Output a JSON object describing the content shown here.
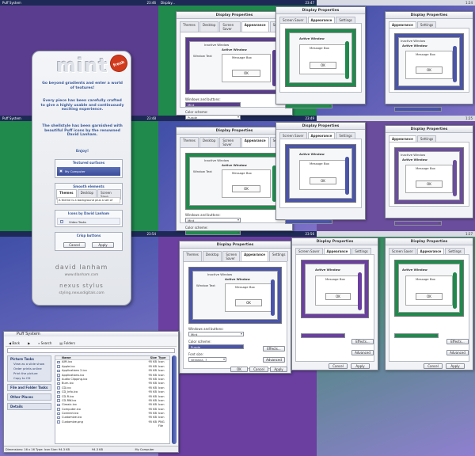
{
  "mint": {
    "logo": "mint",
    "badge": "fresh",
    "para1": "Go beyond gradients and enter a world of textures!",
    "para2": "Every piece has been carefully crafted to give a highly usable and continuously exciting experience.",
    "para3": "The shellstyle has been garnished with beautiful Puff icons by the renowned David Lanham.",
    "para4": "Enjoy!",
    "feature1_caption": "Textured surfaces",
    "feature1_item": "My Computer",
    "feature2_caption": "Smooth elements",
    "feature2_tabs": [
      "Themes",
      "Desktop",
      "Screen Save"
    ],
    "feature2_text": "A theme is a background plus a set of",
    "feature3_caption": "Icons by David Lanham",
    "feature3_item": "Video Tasks",
    "feature4_caption": "Crisp buttons",
    "feature4_cancel": "Cancel",
    "feature4_apply": "Apply",
    "brand1": "david lanham",
    "brand2": "www.dlanham.com",
    "brand3": "nexus stylus",
    "brand4": "styling.nexusdigitals.com"
  },
  "dialog": {
    "title": "Display Properties",
    "tabs": [
      "Themes",
      "Desktop",
      "Screen Saver",
      "Appearance",
      "Settings"
    ],
    "inactive_window": "Inactive Window",
    "active_window": "Active Window",
    "window_text": "Window Text",
    "message_box": "Message Box",
    "ok": "OK",
    "windows_buttons_label": "Windows and buttons:",
    "windows_buttons_value": "Mint",
    "color_scheme_label": "Color scheme:",
    "color_scheme_value": "Purple",
    "font_size_label": "Font size:",
    "font_size_value": "Verdana, 7",
    "effects": "Effects...",
    "advanced": "Advanced",
    "cancel": "Cancel",
    "apply": "Apply"
  },
  "taskbars": [
    {
      "label": "Puff System",
      "clock": "23:46"
    },
    {
      "label": "Display...",
      "clock": "23:47"
    },
    {
      "label": "",
      "clock": "1:24"
    },
    {
      "label": "Puff System",
      "clock": "23:48"
    },
    {
      "label": "",
      "clock": "23:49"
    },
    {
      "label": "",
      "clock": "1:25"
    },
    {
      "label": "",
      "clock": "23:54"
    },
    {
      "label": "",
      "clock": "23:56"
    },
    {
      "label": "",
      "clock": "1:27"
    }
  ],
  "explorer": {
    "title": "Puff System",
    "back": "Back",
    "search": "Search",
    "folders": "Folders",
    "picture_tasks": "Picture Tasks",
    "picture_items": [
      "View as a slide show",
      "Order prints online",
      "Print the picture",
      "Copy to CD"
    ],
    "file_tasks": "File and Folder Tasks",
    "other_places": "Other Places",
    "details": "Details",
    "col_name": "Name",
    "col_size": "Size",
    "col_type": "Type",
    "files": [
      {
        "n": "AIM.ico",
        "s": "95 KB",
        "t": "Icon"
      },
      {
        "n": "Apple.ico",
        "s": "95 KB",
        "t": "Icon"
      },
      {
        "n": "Applications 2.ico",
        "s": "95 KB",
        "t": "Icon"
      },
      {
        "n": "Applications.ico",
        "s": "95 KB",
        "t": "Icon"
      },
      {
        "n": "Audio Clipping.ico",
        "s": "95 KB",
        "t": "Icon"
      },
      {
        "n": "Burn.ico",
        "s": "95 KB",
        "t": "Icon"
      },
      {
        "n": "CD.ico",
        "s": "95 KB",
        "t": "Icon"
      },
      {
        "n": "CD_Info.ico",
        "s": "95 KB",
        "t": "Icon"
      },
      {
        "n": "CD-R.ico",
        "s": "95 KB",
        "t": "Icon"
      },
      {
        "n": "CD-RW.ico",
        "s": "95 KB",
        "t": "Icon"
      },
      {
        "n": "Classic.ico",
        "s": "95 KB",
        "t": "Icon"
      },
      {
        "n": "Computer.ico",
        "s": "95 KB",
        "t": "Icon"
      },
      {
        "n": "Connect.ico",
        "s": "95 KB",
        "t": "Icon"
      },
      {
        "n": "Customize.ico",
        "s": "95 KB",
        "t": "Icon"
      },
      {
        "n": "Customize.png",
        "s": "95 KB",
        "t": "PNG File"
      }
    ],
    "status_left": "Dimensions: 16 x 16 Type: Icon Size: 94.3 KB",
    "status_mid": "94.3 KB",
    "status_right": "My Computer"
  },
  "colors": {
    "purple": "#5b3d8f",
    "green": "#1f8a4c",
    "blue_purple": "#4a54a8",
    "lavender": "#8f7fd0",
    "accent": "#3b4fb0"
  }
}
